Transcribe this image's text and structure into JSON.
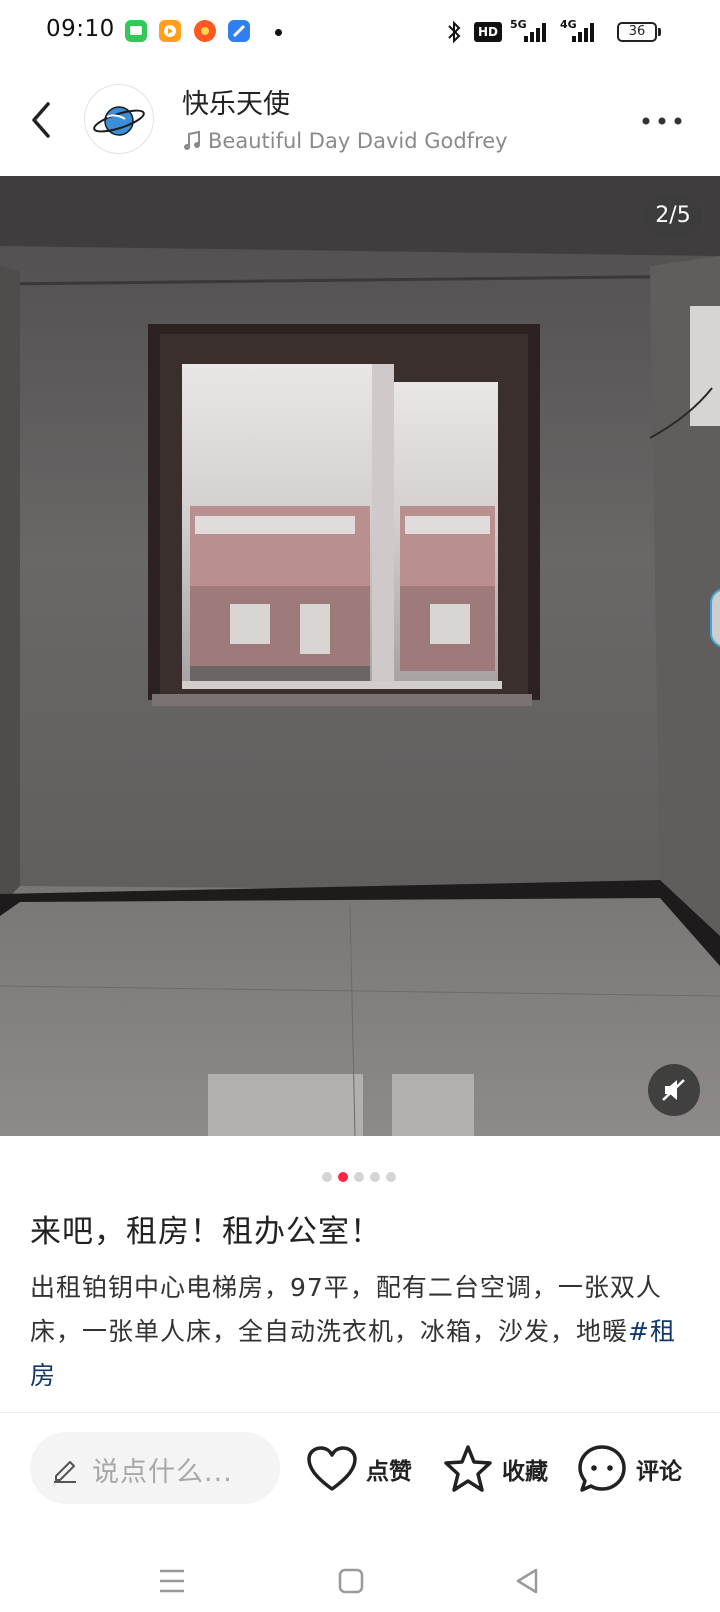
{
  "status_bar": {
    "time": "09:10",
    "network_labels": [
      "HD",
      "5G",
      "4G"
    ],
    "battery_level": "36"
  },
  "header": {
    "username": "快乐天使",
    "music_title": "Beautiful Day David Godfrey"
  },
  "photo": {
    "counter": "2/5"
  },
  "pager": {
    "total": 5,
    "active_index": 1
  },
  "post": {
    "title": "来吧，租房！租办公室！",
    "body": "出租铂钥中心电梯房，97平，配有二台空调，一张双人床，一张单人床，全自动洗衣机，冰箱，沙发，地暖",
    "hashtag": "#租房"
  },
  "actions": {
    "comment_placeholder": "说点什么...",
    "like_label": "点赞",
    "favorite_label": "收藏",
    "comment_label": "评论"
  },
  "colors": {
    "accent": "#ff2442",
    "hashtag": "#13386c"
  }
}
